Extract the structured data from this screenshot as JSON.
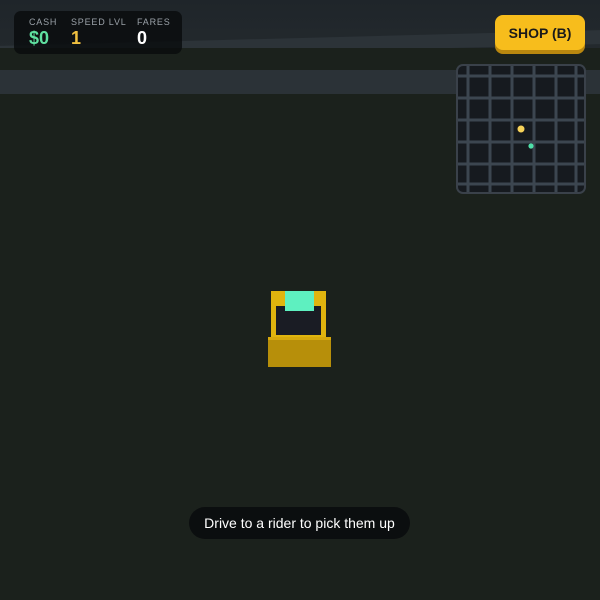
{
  "hud": {
    "cash": {
      "label": "CASH",
      "value": "$0"
    },
    "speed": {
      "label": "SPEED LVL",
      "value": "1"
    },
    "fares": {
      "label": "FARES",
      "value": "0"
    }
  },
  "shop": {
    "label": "SHOP (B)"
  },
  "minimap": {
    "player_marker_color": "#f7d35a",
    "rider_marker_color": "#4ee0a8"
  },
  "taxi": {
    "body_color": "#e0b40e",
    "sign_color": "#5ef0c0"
  },
  "toast": {
    "message": "Drive to a rider to pick them up"
  },
  "colors": {
    "cash": "#5fe0a0",
    "speed": "#f0c040",
    "accent": "#f7bd1c"
  }
}
